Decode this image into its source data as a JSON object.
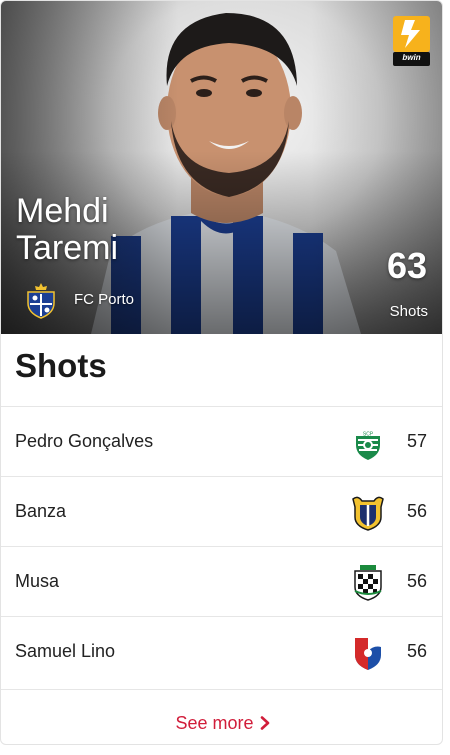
{
  "hero": {
    "first_name": "Mehdi",
    "last_name": "Taremi",
    "club": "FC Porto",
    "stat_value": "63",
    "stat_label": "Shots",
    "league_logo_text": "bwin"
  },
  "section": {
    "title": "Shots"
  },
  "rows": [
    {
      "player": "Pedro Gonçalves",
      "value": "57",
      "crest": "sporting-crest"
    },
    {
      "player": "Banza",
      "value": "56",
      "crest": "famalicao-crest"
    },
    {
      "player": "Musa",
      "value": "56",
      "crest": "boavista-crest"
    },
    {
      "player": "Samuel Lino",
      "value": "56",
      "crest": "gil-vicente-crest"
    }
  ],
  "see_more": "See more",
  "colors": {
    "accent": "#d11d3a",
    "porto_blue": "#1c3f94",
    "text": "#222222"
  }
}
